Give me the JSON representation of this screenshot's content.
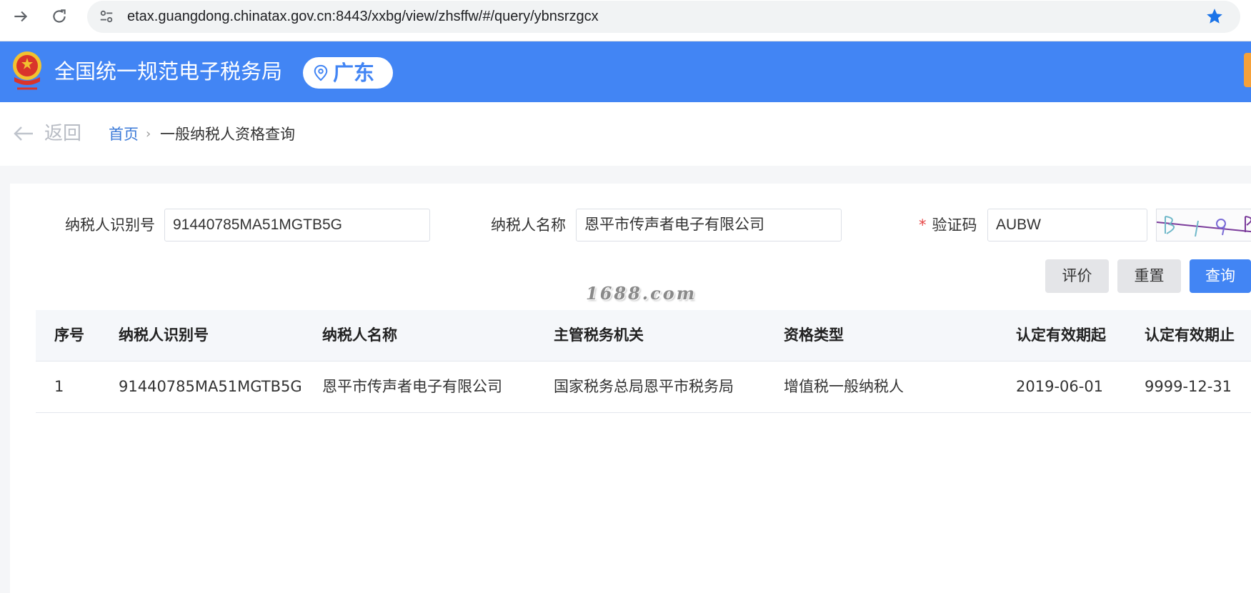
{
  "browser": {
    "url": "etax.guangdong.chinatax.gov.cn:8443/xxbg/view/zhsffw/#/query/ybnsrzgcx",
    "icons": [
      "forward-icon",
      "reload-icon",
      "site-settings-icon",
      "bookmark-star-icon"
    ],
    "accent_color": "#1a73e8"
  },
  "header": {
    "title": "全国统一规范电子税务局",
    "region": "广东",
    "background_color": "#4285f4"
  },
  "breadcrumb": {
    "back_label": "返回",
    "home": "首页",
    "separator": "›",
    "current": "一般纳税人资格查询"
  },
  "form": {
    "taxpayer_id": {
      "label": "纳税人识别号",
      "value": "91440785MA51MGTB5G"
    },
    "taxpayer_name": {
      "label": "纳税人名称",
      "value": "恩平市传声者电子有限公司"
    },
    "captcha": {
      "required_mark": "*",
      "label": "验证码",
      "value": "AUBW"
    }
  },
  "buttons": {
    "evaluate": "评价",
    "reset": "重置",
    "search": "查询"
  },
  "watermark": "1688.com",
  "table": {
    "columns": [
      "序号",
      "纳税人识别号",
      "纳税人名称",
      "主管税务机关",
      "资格类型",
      "认定有效期起",
      "认定有效期止"
    ],
    "rows": [
      [
        "1",
        "91440785MA51MGTB5G",
        "恩平市传声者电子有限公司",
        "国家税务总局恩平市税务局",
        "增值税一般纳税人",
        "2019-06-01",
        "9999-12-31"
      ]
    ]
  }
}
